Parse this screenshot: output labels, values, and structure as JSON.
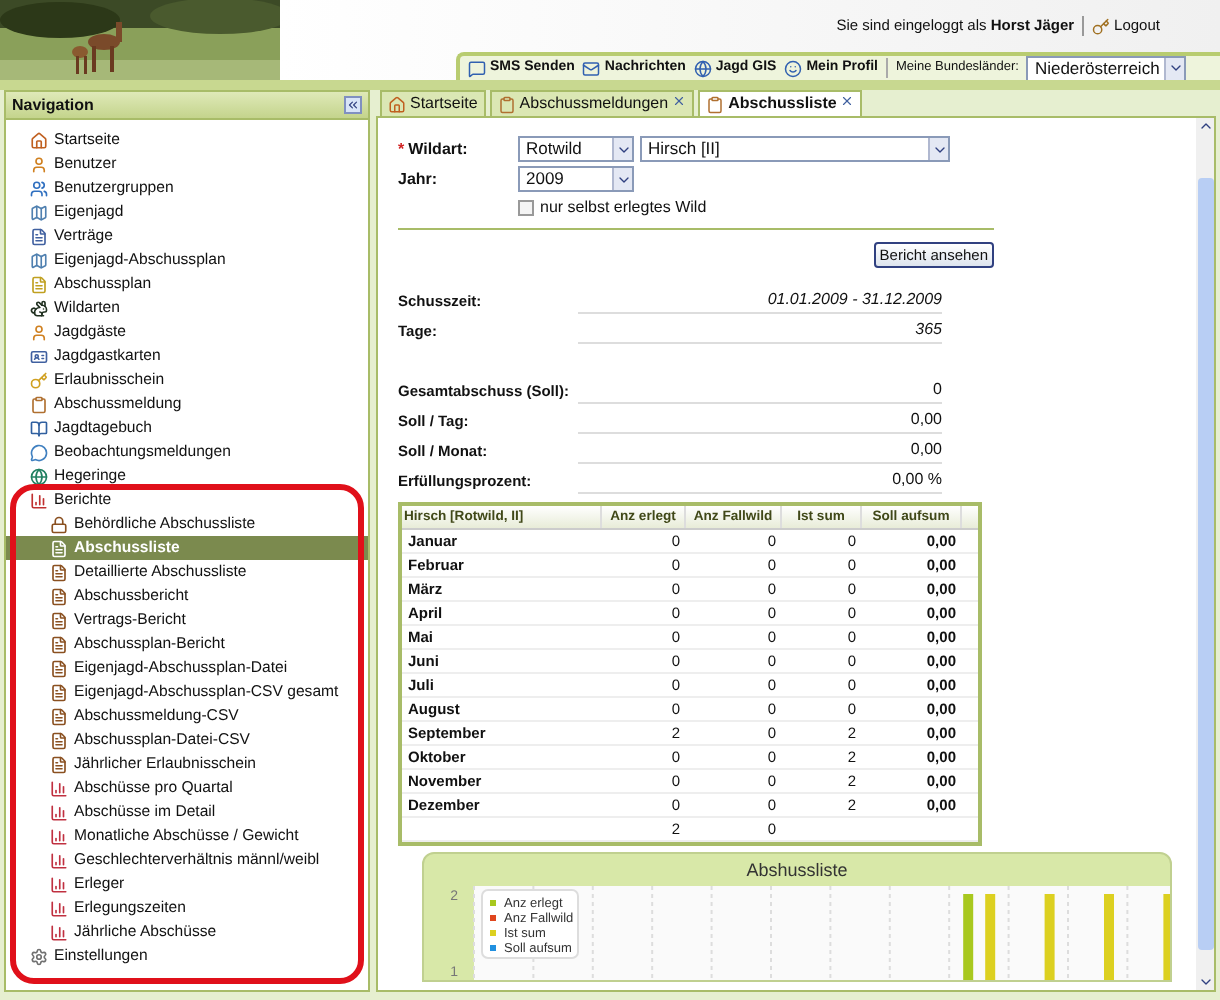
{
  "header": {
    "login_text": "Sie sind eingeloggt als **Horst Jäger**",
    "logout": "Logout"
  },
  "toolbar": {
    "links": [
      "SMS Senden",
      "Nachrichten",
      "Jagd GIS",
      "Mein Profil"
    ],
    "region_label": "Meine Bundesländer:",
    "region_value": "Niederösterreich"
  },
  "navigation": {
    "title": "Navigation",
    "items": [
      {
        "label": "Startseite",
        "selected": false
      },
      {
        "label": "Benutzer",
        "selected": false
      },
      {
        "label": "Benutzergruppen",
        "selected": false
      },
      {
        "label": "Eigenjagd",
        "selected": false
      },
      {
        "label": "Verträge",
        "selected": false
      },
      {
        "label": "Eigenjagd-Abschussplan",
        "selected": false
      },
      {
        "label": "Abschussplan",
        "selected": false
      },
      {
        "label": "Wildarten",
        "selected": false
      },
      {
        "label": "Jagdgäste",
        "selected": false
      },
      {
        "label": "Jagdgastkarten",
        "selected": false
      },
      {
        "label": "Erlaubnisschein",
        "selected": false
      },
      {
        "label": "Abschussmeldung",
        "selected": false
      },
      {
        "label": "Jagdtagebuch",
        "selected": false
      },
      {
        "label": "Beobachtungsmeldungen",
        "selected": false
      },
      {
        "label": "Hegeringe",
        "selected": false
      },
      {
        "label": "Berichte",
        "selected": false,
        "expanded": true,
        "children": [
          {
            "label": "Behördliche Abschussliste",
            "kind": "lock",
            "selected": false
          },
          {
            "label": "Abschussliste",
            "kind": "document",
            "selected": true
          },
          {
            "label": "Detaillierte Abschussliste",
            "kind": "document",
            "selected": false
          },
          {
            "label": "Abschussbericht",
            "kind": "document",
            "selected": false
          },
          {
            "label": "Vertrags-Bericht",
            "kind": "document",
            "selected": false
          },
          {
            "label": "Abschussplan-Bericht",
            "kind": "document",
            "selected": false
          },
          {
            "label": "Eigenjagd-Abschussplan-Datei",
            "kind": "document",
            "selected": false
          },
          {
            "label": "Eigenjagd-Abschussplan-CSV gesamt",
            "kind": "document",
            "selected": false
          },
          {
            "label": "Abschussmeldung-CSV",
            "kind": "document",
            "selected": false
          },
          {
            "label": "Abschussplan-Datei-CSV",
            "kind": "document",
            "selected": false
          },
          {
            "label": "Jährlicher Erlaubnisschein",
            "kind": "document",
            "selected": false
          },
          {
            "label": "Abschüsse pro Quartal",
            "kind": "chart",
            "selected": false
          },
          {
            "label": "Abschüsse im Detail",
            "kind": "chart",
            "selected": false
          },
          {
            "label": "Monatliche Abschüsse / Gewicht",
            "kind": "chart",
            "selected": false
          },
          {
            "label": "Geschlechterverhältnis männl/weibl",
            "kind": "chart",
            "selected": false
          },
          {
            "label": "Erleger",
            "kind": "chart",
            "selected": false
          },
          {
            "label": "Erlegungszeiten",
            "kind": "chart",
            "selected": false
          },
          {
            "label": "Jährliche Abschüsse",
            "kind": "chart",
            "selected": false
          }
        ]
      },
      {
        "label": "Einstellungen",
        "selected": false,
        "expanded": false
      }
    ]
  },
  "tabs": [
    {
      "label": "Startseite",
      "selected": false,
      "closable": false
    },
    {
      "label": "Abschussmeldungen",
      "selected": false,
      "closable": true
    },
    {
      "label": "Abschussliste",
      "selected": true,
      "closable": true
    }
  ],
  "form": {
    "required_mark": "*",
    "wildart_label": "Wildart:",
    "wildart": "Rotwild",
    "subtype": "Hirsch [II]",
    "year_label": "Jahr:",
    "year": "2009",
    "own_only": {
      "label": "nur selbst erlegtes Wild",
      "checked": false
    },
    "submit": "Bericht ansehen"
  },
  "details": [
    {
      "label": "Schusszeit:",
      "value": "01.01.2009 - 31.12.2009",
      "italic": true,
      "gap_before": false
    },
    {
      "label": "Tage:",
      "value": "365",
      "italic": true,
      "gap_before": false
    },
    {
      "label": "Gesamtabschuss (Soll):",
      "value": "0",
      "italic": false,
      "gap_before": true
    },
    {
      "label": "Soll / Tag:",
      "value": "0,00",
      "italic": false,
      "gap_before": false
    },
    {
      "label": "Soll / Monat:",
      "value": "0,00",
      "italic": false,
      "gap_before": false
    },
    {
      "label": "Erfüllungsprozent:",
      "value": "0,00 %",
      "italic": false,
      "gap_before": false
    }
  ],
  "table": {
    "columns": [
      "Hirsch [Rotwild, II]",
      "Anz erlegt",
      "Anz Fallwild",
      "Ist sum",
      "Soll aufsum"
    ],
    "rows": [
      [
        "Januar",
        "0",
        "0",
        "0",
        "0,00"
      ],
      [
        "Februar",
        "0",
        "0",
        "0",
        "0,00"
      ],
      [
        "März",
        "0",
        "0",
        "0",
        "0,00"
      ],
      [
        "April",
        "0",
        "0",
        "0",
        "0,00"
      ],
      [
        "Mai",
        "0",
        "0",
        "0",
        "0,00"
      ],
      [
        "Juni",
        "0",
        "0",
        "0",
        "0,00"
      ],
      [
        "Juli",
        "0",
        "0",
        "0",
        "0,00"
      ],
      [
        "August",
        "0",
        "0",
        "0",
        "0,00"
      ],
      [
        "September",
        "2",
        "0",
        "2",
        "0,00"
      ],
      [
        "Oktober",
        "0",
        "0",
        "2",
        "0,00"
      ],
      [
        "November",
        "0",
        "0",
        "2",
        "0,00"
      ],
      [
        "Dezember",
        "0",
        "0",
        "2",
        "0,00"
      ]
    ],
    "total": {
      "anz_erlegt": "2",
      "anz_fallwild": "0"
    }
  },
  "chart": {
    "title": "Abshussliste",
    "axis_labels": [
      "2",
      "1"
    ],
    "legend": [
      {
        "name": "Anz erlegt",
        "color": "#a8c81e"
      },
      {
        "name": "Anz Fallwild",
        "color": "#e0461e"
      },
      {
        "name": "Ist sum",
        "color": "#dcd020"
      },
      {
        "name": "Soll aufsum",
        "color": "#2090e0"
      }
    ]
  }
}
